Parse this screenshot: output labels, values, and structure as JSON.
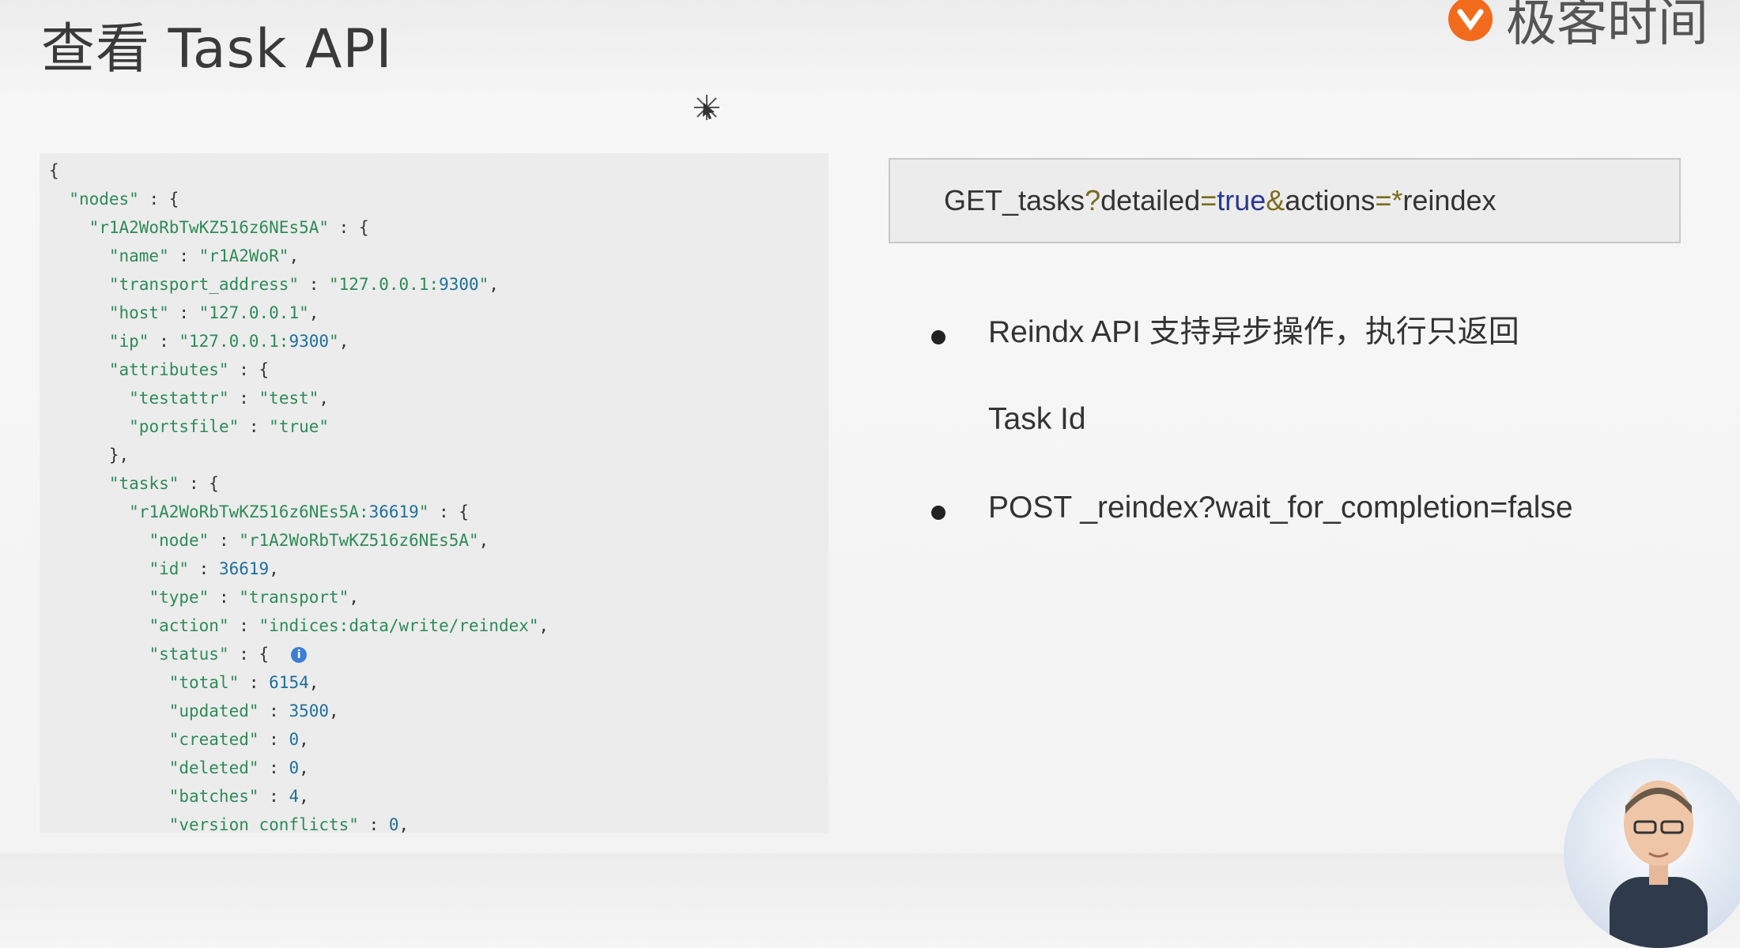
{
  "slide": {
    "title": "查看 Task API",
    "brand_text": "极客时间",
    "brand_logo_icon": "geektime-logo-icon",
    "cursor_icon": "cursor-sparkle-icon"
  },
  "code": {
    "lines": [
      "{",
      "  \"nodes\" : {",
      "    \"r1A2WoRbTwKZ516z6NEs5A\" : {",
      "      \"name\" : \"r1A2WoR\",",
      "      \"transport_address\" : \"127.0.0.1:9300\",",
      "      \"host\" : \"127.0.0.1\",",
      "      \"ip\" : \"127.0.0.1:9300\",",
      "      \"attributes\" : {",
      "        \"testattr\" : \"test\",",
      "        \"portsfile\" : \"true\"",
      "      },",
      "      \"tasks\" : {",
      "        \"r1A2WoRbTwKZ516z6NEs5A:36619\" : {",
      "          \"node\" : \"r1A2WoRbTwKZ516z6NEs5A\",",
      "          \"id\" : 36619,",
      "          \"type\" : \"transport\",",
      "          \"action\" : \"indices:data/write/reindex\",",
      "          \"status\" : {",
      "            \"total\" : 6154,",
      "            \"updated\" : 3500,",
      "            \"created\" : 0,",
      "            \"deleted\" : 0,",
      "            \"batches\" : 4,",
      "            \"version_conflicts\" : 0,"
    ],
    "info_icon_line": 17,
    "info_icon": "info-icon"
  },
  "request": {
    "method": "GET",
    "path": " _tasks",
    "q": "?",
    "p1": "detailed",
    "eq1": "=",
    "v1": "true",
    "amp": "&",
    "p2": "actions",
    "eq2": "=",
    "star": "*",
    "v2": "reindex"
  },
  "bullets": [
    {
      "lines": [
        "Reindx API 支持异步操作，执行只返回",
        "Task Id"
      ]
    },
    {
      "lines": [
        "POST _reindex?wait_for_completion=false"
      ]
    }
  ],
  "colors": {
    "code_key": "#2e8b57",
    "code_number": "#1f6f9a",
    "brand_orange": "#f26b1d"
  },
  "presenter": {
    "avatar_icon": "presenter-video-avatar"
  }
}
